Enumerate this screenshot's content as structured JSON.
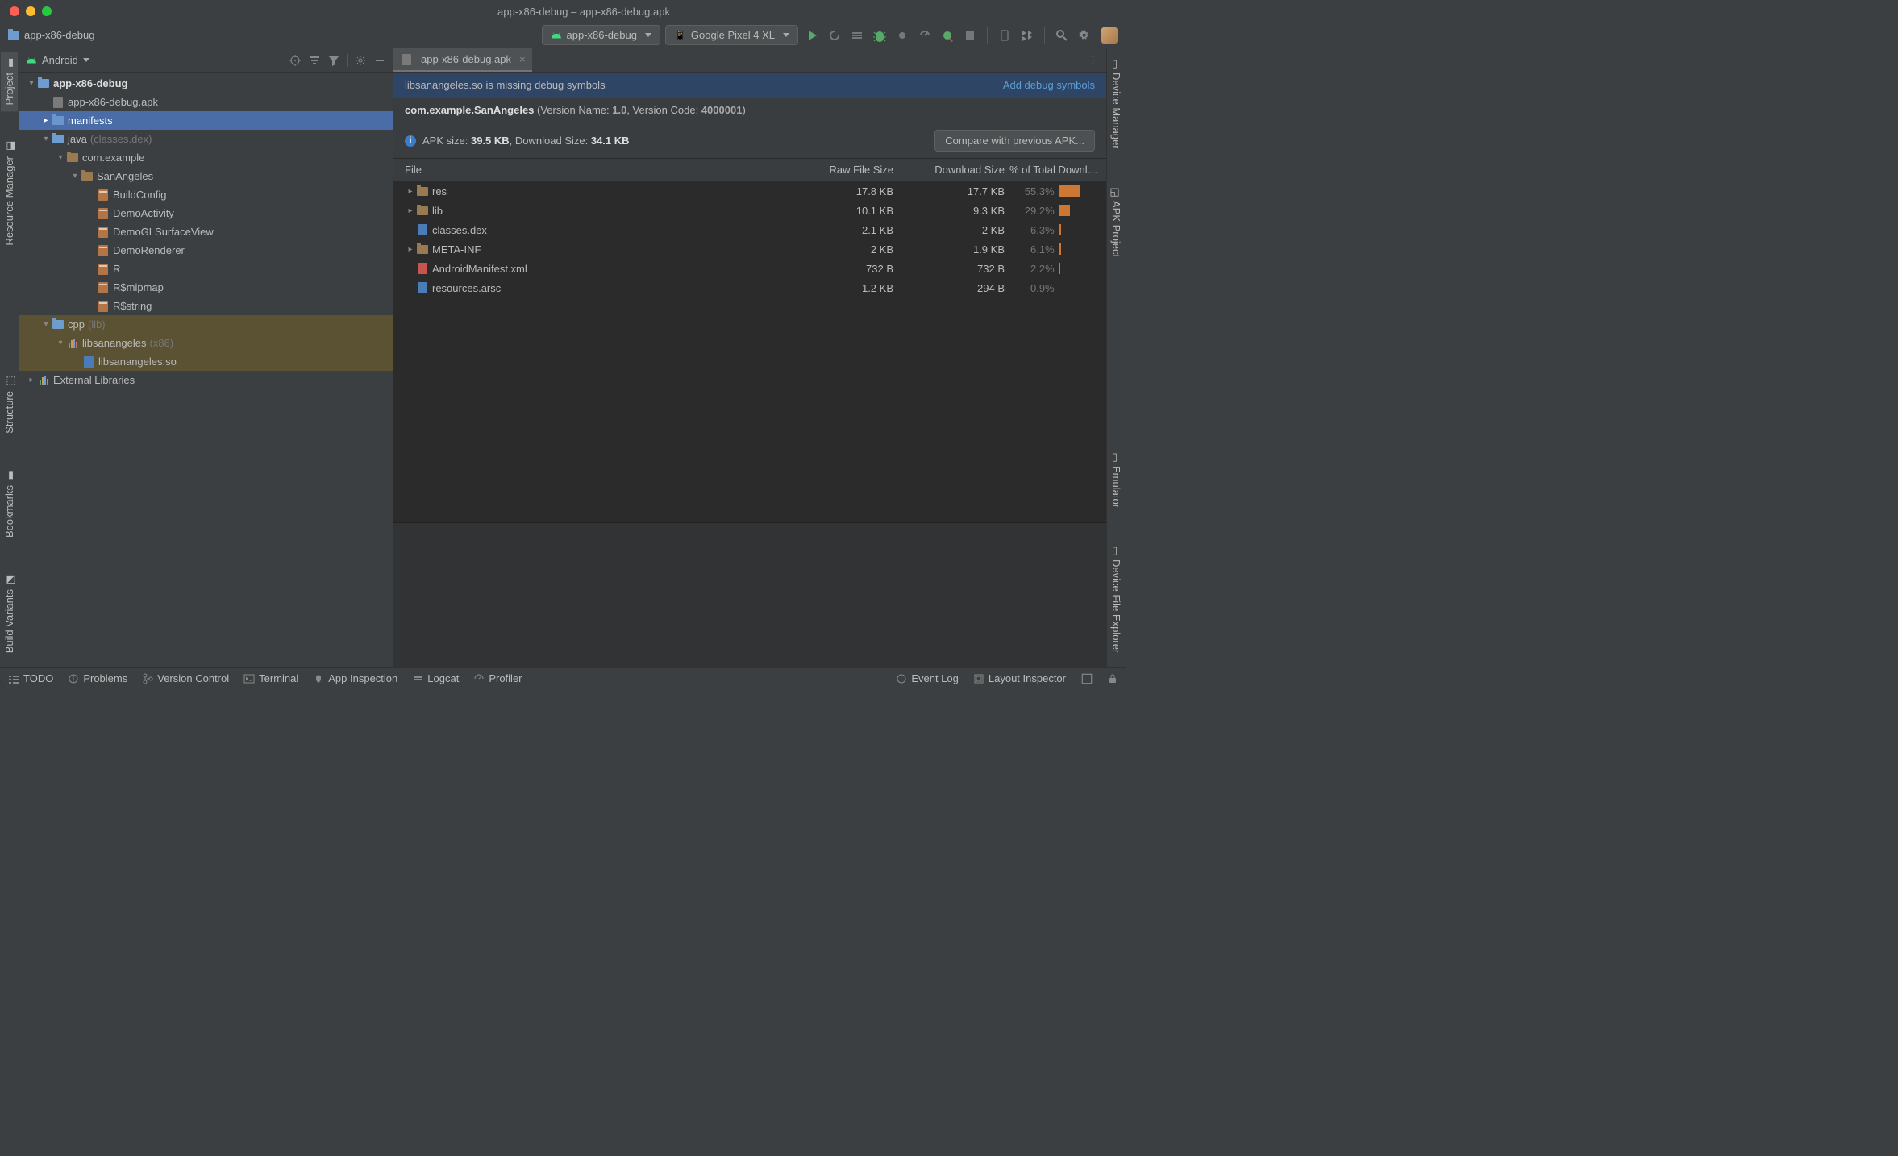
{
  "window_title": "app-x86-debug – app-x86-debug.apk",
  "breadcrumb": "app-x86-debug",
  "run_config": "app-x86-debug",
  "device": "Google Pixel 4 XL",
  "project_view": "Android",
  "left_tabs": [
    "Project",
    "Resource Manager",
    "Structure",
    "Bookmarks",
    "Build Variants"
  ],
  "right_tabs": [
    "Device Manager",
    "APK Project",
    "Emulator",
    "Device File Explorer"
  ],
  "tree": {
    "root": "app-x86-debug",
    "apk": "app-x86-debug.apk",
    "manifests": "manifests",
    "java": "java",
    "java_hint": "(classes.dex)",
    "pkg1": "com.example",
    "pkg2": "SanAngeles",
    "files": [
      "BuildConfig",
      "DemoActivity",
      "DemoGLSurfaceView",
      "DemoRenderer",
      "R",
      "R$mipmap",
      "R$string"
    ],
    "cpp": "cpp",
    "cpp_hint": "(lib)",
    "nlib": "libsanangeles",
    "nlib_hint": "(x86)",
    "so": "libsanangeles.so",
    "ext": "External Libraries"
  },
  "editor_tab": "app-x86-debug.apk",
  "warning": "libsanangeles.so is missing debug symbols",
  "warning_action": "Add debug symbols",
  "package": {
    "name": "com.example.SanAngeles",
    "vname_l": "(Version Name: ",
    "vname": "1.0",
    "vcode_l": ", Version Code: ",
    "vcode": "4000001",
    "close": ")"
  },
  "size_line": {
    "a": "APK size: ",
    "av": "39.5 KB",
    "b": ", Download Size: ",
    "bv": "34.1 KB"
  },
  "compare": "Compare with previous APK...",
  "headers": {
    "c1": "File",
    "c2": "Raw File Size",
    "c3": "Download Size",
    "c4": "% of Total Downlo..."
  },
  "rows": [
    {
      "name": "res",
      "raw": "17.8 KB",
      "dl": "17.7 KB",
      "pct": "55.3%",
      "bar": 55,
      "exp": true,
      "icon": "fold"
    },
    {
      "name": "lib",
      "raw": "10.1 KB",
      "dl": "9.3 KB",
      "pct": "29.2%",
      "bar": 29,
      "exp": true,
      "icon": "fold"
    },
    {
      "name": "classes.dex",
      "raw": "2.1 KB",
      "dl": "2 KB",
      "pct": "6.3%",
      "bar": 6,
      "exp": false,
      "icon": "sof"
    },
    {
      "name": "META-INF",
      "raw": "2 KB",
      "dl": "1.9 KB",
      "pct": "6.1%",
      "bar": 6,
      "exp": true,
      "icon": "fold"
    },
    {
      "name": "AndroidManifest.xml",
      "raw": "732 B",
      "dl": "732 B",
      "pct": "2.2%",
      "bar": 3,
      "exp": false,
      "icon": "xml"
    },
    {
      "name": "resources.arsc",
      "raw": "1.2 KB",
      "dl": "294 B",
      "pct": "0.9%",
      "bar": 0,
      "exp": false,
      "icon": "arsc"
    }
  ],
  "status": [
    "TODO",
    "Problems",
    "Version Control",
    "Terminal",
    "App Inspection",
    "Logcat",
    "Profiler"
  ],
  "status_r": [
    "Event Log",
    "Layout Inspector"
  ]
}
